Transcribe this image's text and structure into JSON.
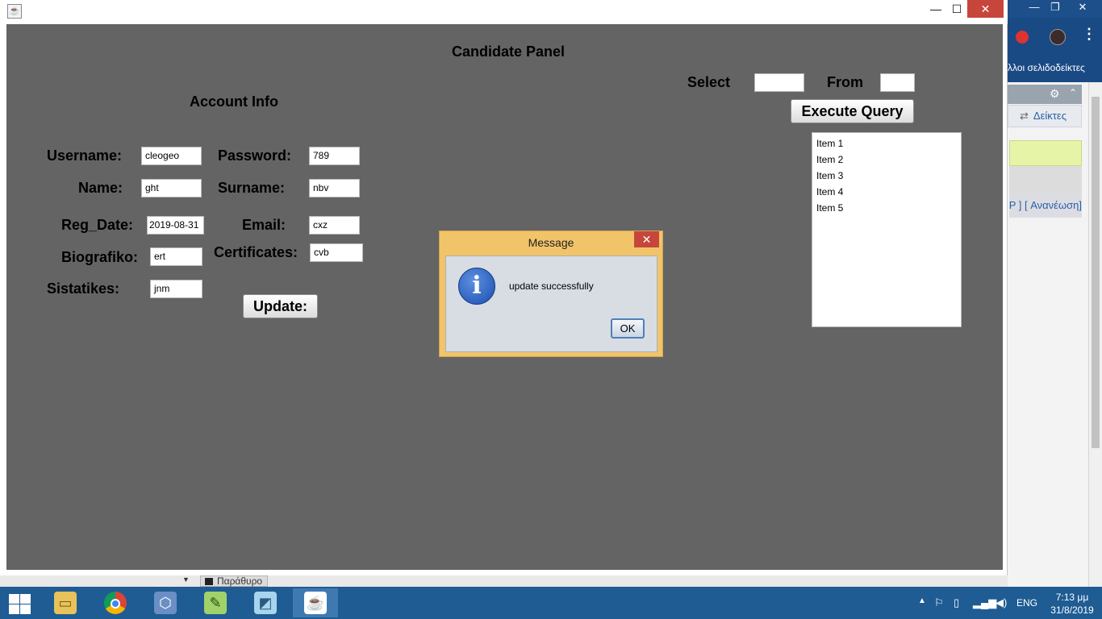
{
  "window": {
    "minimize": "—",
    "maximize": "☐",
    "close": "✕"
  },
  "panel": {
    "title": "Candidate  Panel",
    "account_info": "Account Info",
    "username_label": "Username:",
    "username_value": "cleogeo",
    "password_label": "Password:",
    "password_value": "789",
    "name_label": "Name:",
    "name_value": "ght",
    "surname_label": "Surname:",
    "surname_value": "nbv",
    "reg_date_label": "Reg_Date:",
    "reg_date_value": "2019-08-31",
    "email_label": "Email:",
    "email_value": "cxz",
    "biografiko_label": "Biografiko:",
    "biografiko_value": "ert",
    "certificates_label": "Certificates:",
    "certificates_value": "cvb",
    "sistatikes_label": "Sistatikes:",
    "sistatikes_value": "jnm",
    "update_button": "Update:"
  },
  "query": {
    "select_label": "Select",
    "select_value": "",
    "from_label": "From",
    "from_value": "",
    "execute_button": "Execute Query",
    "items": [
      "Item 1",
      "Item 2",
      "Item 3",
      "Item 4",
      "Item 5"
    ]
  },
  "dialog": {
    "title": "Message",
    "close": "✕",
    "message": "update successfully",
    "ok": "OK"
  },
  "browser": {
    "bookmarks": "λλοι σελιδοδείκτες",
    "tab": "Δείκτες",
    "links": "P ] [ Ανανέωση]"
  },
  "behind_window": {
    "tab": "Παράθυρο"
  },
  "taskbar": {
    "lang": "ENG",
    "time": "7:13 μμ",
    "date": "31/8/2019",
    "icons": [
      "file-explorer-icon",
      "chrome-icon",
      "virtualbox-icon",
      "notepad-plus-plus-icon",
      "paint-icon",
      "java-icon"
    ]
  },
  "colors": {
    "panel_bg": "#646464",
    "dialog_frame": "#f1c46a",
    "taskbar": "#1f5c94",
    "close_red": "#c7463b"
  }
}
